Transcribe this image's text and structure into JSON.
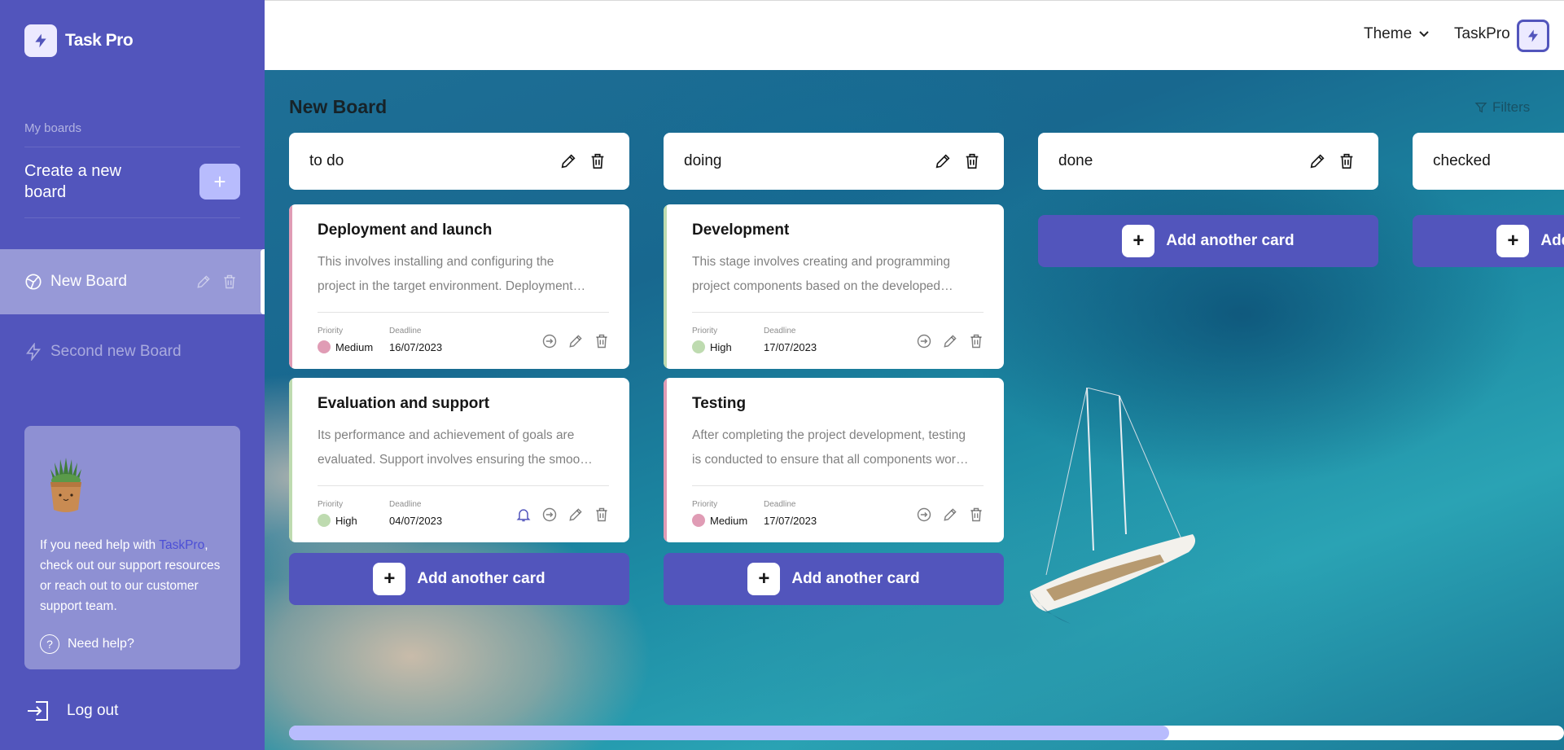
{
  "sidebar": {
    "logo_text": "Task Pro",
    "my_boards_label": "My boards",
    "create_board_label": "Create a new board",
    "create_board_button": "+",
    "boards": [
      {
        "name": "New Board",
        "icon": "puzzle-icon",
        "active": true
      },
      {
        "name": "Second new Board",
        "icon": "lightning-icon",
        "active": false
      }
    ],
    "help": {
      "text_before": "If you need help with ",
      "link": "TaskPro",
      "text_after": ", check out our support resources or reach out to our customer support team.",
      "need_help_label": "Need help?"
    },
    "logout_label": "Log out"
  },
  "header": {
    "theme_label": "Theme",
    "username": "TaskPro"
  },
  "board": {
    "title": "New Board",
    "filters_label": "Filters",
    "columns": [
      {
        "title": "to do",
        "cards": [
          {
            "title": "Deployment and launch",
            "description": "This involves installing and configuring the project in the target environment. Deployment may include migrating data and setting up servers.",
            "priority_label": "Priority",
            "priority": "Medium",
            "priority_color": "#e09cb5",
            "deadline_label": "Deadline",
            "deadline": "16/07/2023",
            "bell": false
          },
          {
            "title": "Evaluation and support",
            "description": "Its performance and achievement of goals are evaluated. Support involves ensuring the smooth operation of the project after launch.",
            "priority_label": "Priority",
            "priority": "High",
            "priority_color": "#bedbb0",
            "deadline_label": "Deadline",
            "deadline": "04/07/2023",
            "bell": true
          }
        ],
        "add_label": "Add another card"
      },
      {
        "title": "doing",
        "cards": [
          {
            "title": "Development",
            "description": "This stage involves creating and programming project components based on the developed design and requirements.",
            "priority_label": "Priority",
            "priority": "High",
            "priority_color": "#bedbb0",
            "deadline_label": "Deadline",
            "deadline": "17/07/2023",
            "bell": false
          },
          {
            "title": "Testing",
            "description": "After completing the project development, testing is conducted to ensure that all components work correctly.",
            "priority_label": "Priority",
            "priority": "Medium",
            "priority_color": "#e09cb5",
            "deadline_label": "Deadline",
            "deadline": "17/07/2023",
            "bell": false
          }
        ],
        "add_label": "Add another card"
      },
      {
        "title": "done",
        "cards": [],
        "add_label": "Add another card"
      },
      {
        "title": "checked",
        "cards": [],
        "add_label": "Add another card"
      }
    ]
  },
  "scroll_progress": 0.69,
  "colors": {
    "accent": "#5255bc",
    "accent_light": "#b8bcfd",
    "priority_medium": "#e09cb5",
    "priority_high": "#bedbb0"
  }
}
